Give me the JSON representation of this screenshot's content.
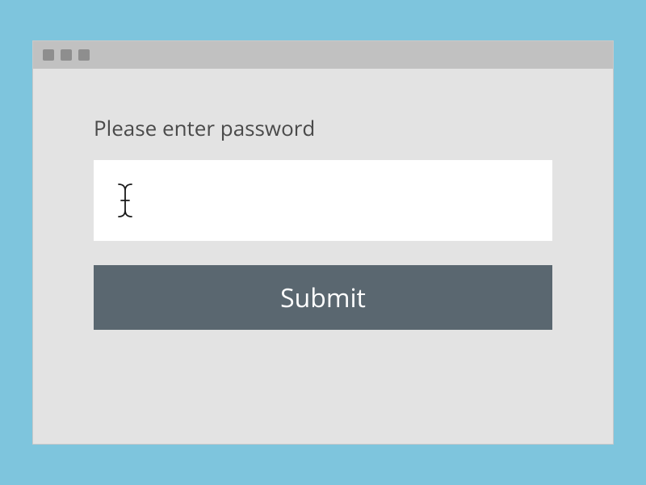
{
  "form": {
    "label": "Please enter password",
    "input_value": "",
    "submit_label": "Submit"
  },
  "colors": {
    "background": "#7ec5dd",
    "window_bg": "#e3e3e3",
    "titlebar_bg": "#c1c1c1",
    "dot": "#8e8e8e",
    "button_bg": "#5a6770",
    "text": "#4a4a4a"
  }
}
